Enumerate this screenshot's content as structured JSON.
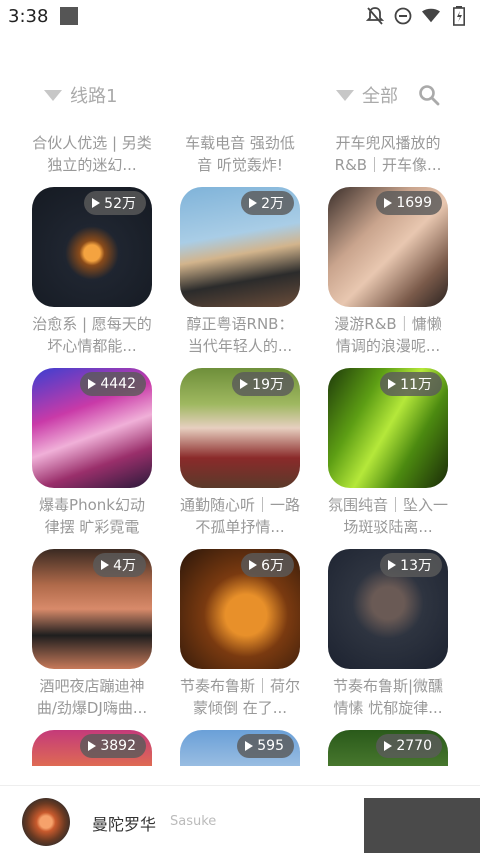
{
  "status_bar": {
    "time": "3:38",
    "icons": [
      "bell-off-icon",
      "dnd-icon",
      "wifi-icon",
      "battery-icon"
    ]
  },
  "filter": {
    "line_label": "线路1",
    "category_label": "全部"
  },
  "top_partial_titles": [
    "合伙人优选 | 另类独立的迷幻...",
    "车载电音 强劲低音 听觉轰炸!",
    "开车兜风播放的R&B｜开车像..."
  ],
  "playlists": [
    {
      "count": "52万",
      "title": "治愈系 | 愿每天的坏心情都能..."
    },
    {
      "count": "2万",
      "title": "醇正粤语RNB：当代年轻人的..."
    },
    {
      "count": "1699",
      "title": "漫游R&B｜慵懒情调的浪漫呢..."
    },
    {
      "count": "4442",
      "title": "爆毒Phonk幻动律摆 旷彩霓電"
    },
    {
      "count": "19万",
      "title": "通勤随心听｜一路不孤单抒情..."
    },
    {
      "count": "11万",
      "title": "氛围纯音｜坠入一场斑驳陆离..."
    },
    {
      "count": "4万",
      "title": "酒吧夜店蹦迪神曲/劲爆DJ嗨曲..."
    },
    {
      "count": "6万",
      "title": "节奏布鲁斯｜荷尔蒙倾倒 在了..."
    },
    {
      "count": "13万",
      "title": "节奏布鲁斯|微醺情愫 忧郁旋律..."
    },
    {
      "count": "3892",
      "title": ""
    },
    {
      "count": "595",
      "title": ""
    },
    {
      "count": "2770",
      "title": ""
    }
  ],
  "player": {
    "song": "曼陀罗华",
    "artist": "Sasuke"
  }
}
